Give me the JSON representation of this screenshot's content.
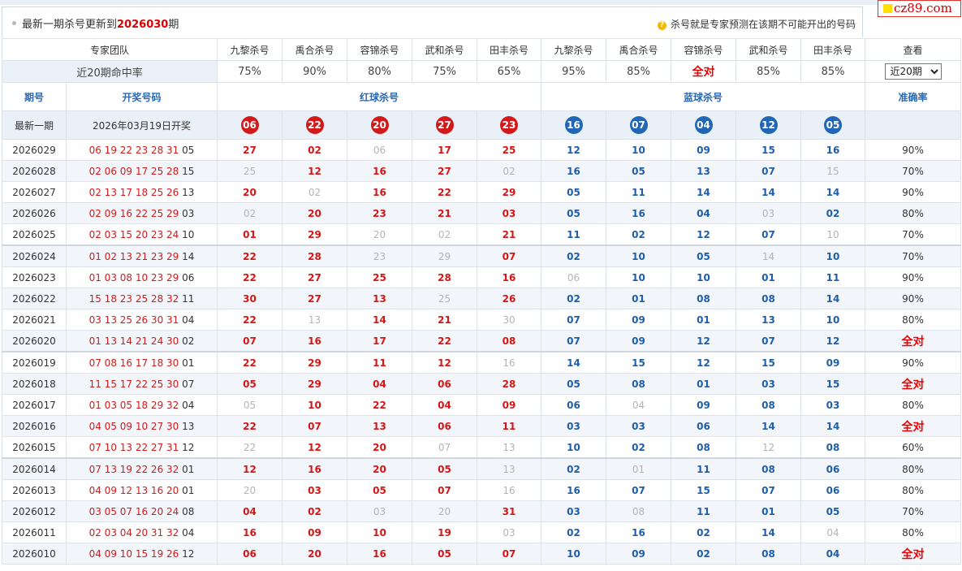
{
  "header": {
    "title_prefix": "最新一期杀号更新到",
    "latest_issue": "2026030",
    "title_suffix": "期",
    "notice": "杀号就是专家预测在该期不可能开出的号码",
    "notice_icon": "question-icon"
  },
  "logo": {
    "text": "cz89.com"
  },
  "team_row": {
    "label": "专家团队",
    "experts": [
      "九黎杀号",
      "禹合杀号",
      "容锦杀号",
      "武和杀号",
      "田丰杀号",
      "九黎杀号",
      "禹合杀号",
      "容锦杀号",
      "武和杀号",
      "田丰杀号"
    ],
    "view_label": "查看"
  },
  "rate_row": {
    "label": "近20期命中率",
    "rates": [
      "75%",
      "90%",
      "80%",
      "75%",
      "65%",
      "95%",
      "85%",
      "全对",
      "85%",
      "85%"
    ],
    "select_value": "近20期"
  },
  "col_headers": {
    "period": "期号",
    "draw": "开奖号码",
    "red_kill": "红球杀号",
    "blue_kill": "蓝球杀号",
    "accuracy": "准确率"
  },
  "latest": {
    "label": "最新一期",
    "draw_date": "2026年03月19日开奖",
    "red": [
      "06",
      "22",
      "20",
      "27",
      "23"
    ],
    "blue": [
      "16",
      "07",
      "04",
      "12",
      "05"
    ]
  },
  "rows": [
    {
      "period": "2026029",
      "draw_red": "06 19 22 23 28 31",
      "draw_blue": "05",
      "red": [
        "27",
        "02",
        "06",
        "17",
        "25"
      ],
      "red_miss": [
        false,
        false,
        true,
        false,
        false
      ],
      "blue": [
        "12",
        "10",
        "09",
        "15",
        "16"
      ],
      "blue_miss": [
        false,
        false,
        false,
        false,
        false
      ],
      "acc": "90%"
    },
    {
      "period": "2026028",
      "draw_red": "02 06 09 17 25 28",
      "draw_blue": "15",
      "red": [
        "25",
        "12",
        "16",
        "27",
        "02"
      ],
      "red_miss": [
        true,
        false,
        false,
        false,
        true
      ],
      "blue": [
        "16",
        "05",
        "13",
        "07",
        "15"
      ],
      "blue_miss": [
        false,
        false,
        false,
        false,
        true
      ],
      "acc": "70%"
    },
    {
      "period": "2026027",
      "draw_red": "02 13 17 18 25 26",
      "draw_blue": "13",
      "red": [
        "20",
        "02",
        "16",
        "22",
        "29"
      ],
      "red_miss": [
        false,
        true,
        false,
        false,
        false
      ],
      "blue": [
        "05",
        "11",
        "14",
        "14",
        "14"
      ],
      "blue_miss": [
        false,
        false,
        false,
        false,
        false
      ],
      "acc": "90%"
    },
    {
      "period": "2026026",
      "draw_red": "02 09 16 22 25 29",
      "draw_blue": "03",
      "red": [
        "02",
        "20",
        "23",
        "21",
        "03"
      ],
      "red_miss": [
        true,
        false,
        false,
        false,
        false
      ],
      "blue": [
        "05",
        "16",
        "04",
        "03",
        "02"
      ],
      "blue_miss": [
        false,
        false,
        false,
        true,
        false
      ],
      "acc": "80%"
    },
    {
      "period": "2026025",
      "draw_red": "02 03 15 20 23 24",
      "draw_blue": "10",
      "red": [
        "01",
        "29",
        "20",
        "02",
        "21"
      ],
      "red_miss": [
        false,
        false,
        true,
        true,
        false
      ],
      "blue": [
        "11",
        "02",
        "12",
        "07",
        "10"
      ],
      "blue_miss": [
        false,
        false,
        false,
        false,
        true
      ],
      "acc": "70%"
    },
    {
      "period": "2026024",
      "draw_red": "01 02 13 21 23 29",
      "draw_blue": "14",
      "red": [
        "22",
        "28",
        "23",
        "29",
        "07"
      ],
      "red_miss": [
        false,
        false,
        true,
        true,
        false
      ],
      "blue": [
        "02",
        "10",
        "05",
        "14",
        "10"
      ],
      "blue_miss": [
        false,
        false,
        false,
        true,
        false
      ],
      "acc": "70%"
    },
    {
      "period": "2026023",
      "draw_red": "01 03 08 10 23 29",
      "draw_blue": "06",
      "red": [
        "22",
        "27",
        "25",
        "28",
        "16"
      ],
      "red_miss": [
        false,
        false,
        false,
        false,
        false
      ],
      "blue": [
        "06",
        "10",
        "10",
        "01",
        "11"
      ],
      "blue_miss": [
        true,
        false,
        false,
        false,
        false
      ],
      "acc": "90%"
    },
    {
      "period": "2026022",
      "draw_red": "15 18 23 25 28 32",
      "draw_blue": "11",
      "red": [
        "30",
        "27",
        "13",
        "25",
        "26"
      ],
      "red_miss": [
        false,
        false,
        false,
        true,
        false
      ],
      "blue": [
        "02",
        "01",
        "08",
        "08",
        "14"
      ],
      "blue_miss": [
        false,
        false,
        false,
        false,
        false
      ],
      "acc": "90%"
    },
    {
      "period": "2026021",
      "draw_red": "03 13 25 26 30 31",
      "draw_blue": "04",
      "red": [
        "22",
        "13",
        "14",
        "21",
        "30"
      ],
      "red_miss": [
        false,
        true,
        false,
        false,
        true
      ],
      "blue": [
        "07",
        "09",
        "01",
        "13",
        "10"
      ],
      "blue_miss": [
        false,
        false,
        false,
        false,
        false
      ],
      "acc": "80%"
    },
    {
      "period": "2026020",
      "draw_red": "01 13 14 21 24 30",
      "draw_blue": "02",
      "red": [
        "07",
        "16",
        "17",
        "22",
        "08"
      ],
      "red_miss": [
        false,
        false,
        false,
        false,
        false
      ],
      "blue": [
        "07",
        "09",
        "12",
        "07",
        "12"
      ],
      "blue_miss": [
        false,
        false,
        false,
        false,
        false
      ],
      "acc": "全对"
    },
    {
      "period": "2026019",
      "draw_red": "07 08 16 17 18 30",
      "draw_blue": "01",
      "red": [
        "22",
        "29",
        "11",
        "12",
        "16"
      ],
      "red_miss": [
        false,
        false,
        false,
        false,
        true
      ],
      "blue": [
        "14",
        "15",
        "12",
        "15",
        "09"
      ],
      "blue_miss": [
        false,
        false,
        false,
        false,
        false
      ],
      "acc": "90%"
    },
    {
      "period": "2026018",
      "draw_red": "11 15 17 22 25 30",
      "draw_blue": "07",
      "red": [
        "05",
        "29",
        "04",
        "06",
        "28"
      ],
      "red_miss": [
        false,
        false,
        false,
        false,
        false
      ],
      "blue": [
        "05",
        "08",
        "01",
        "03",
        "15"
      ],
      "blue_miss": [
        false,
        false,
        false,
        false,
        false
      ],
      "acc": "全对"
    },
    {
      "period": "2026017",
      "draw_red": "01 03 05 18 29 32",
      "draw_blue": "04",
      "red": [
        "05",
        "10",
        "22",
        "04",
        "09"
      ],
      "red_miss": [
        true,
        false,
        false,
        false,
        false
      ],
      "blue": [
        "06",
        "04",
        "09",
        "08",
        "03"
      ],
      "blue_miss": [
        false,
        true,
        false,
        false,
        false
      ],
      "acc": "80%"
    },
    {
      "period": "2026016",
      "draw_red": "04 05 09 10 27 30",
      "draw_blue": "13",
      "red": [
        "22",
        "07",
        "13",
        "06",
        "11"
      ],
      "red_miss": [
        false,
        false,
        false,
        false,
        false
      ],
      "blue": [
        "03",
        "03",
        "06",
        "14",
        "14"
      ],
      "blue_miss": [
        false,
        false,
        false,
        false,
        false
      ],
      "acc": "全对"
    },
    {
      "period": "2026015",
      "draw_red": "07 10 13 22 27 31",
      "draw_blue": "12",
      "red": [
        "22",
        "12",
        "20",
        "07",
        "13"
      ],
      "red_miss": [
        true,
        false,
        false,
        true,
        true
      ],
      "blue": [
        "10",
        "02",
        "08",
        "12",
        "08"
      ],
      "blue_miss": [
        false,
        false,
        false,
        true,
        false
      ],
      "acc": "60%"
    },
    {
      "period": "2026014",
      "draw_red": "07 13 19 22 26 32",
      "draw_blue": "01",
      "red": [
        "12",
        "16",
        "20",
        "05",
        "13"
      ],
      "red_miss": [
        false,
        false,
        false,
        false,
        true
      ],
      "blue": [
        "02",
        "01",
        "11",
        "08",
        "06"
      ],
      "blue_miss": [
        false,
        true,
        false,
        false,
        false
      ],
      "acc": "80%"
    },
    {
      "period": "2026013",
      "draw_red": "04 09 12 13 16 20",
      "draw_blue": "01",
      "red": [
        "20",
        "03",
        "05",
        "07",
        "16"
      ],
      "red_miss": [
        true,
        false,
        false,
        false,
        true
      ],
      "blue": [
        "16",
        "07",
        "15",
        "07",
        "06"
      ],
      "blue_miss": [
        false,
        false,
        false,
        false,
        false
      ],
      "acc": "80%"
    },
    {
      "period": "2026012",
      "draw_red": "03 05 07 16 20 24",
      "draw_blue": "08",
      "red": [
        "04",
        "02",
        "03",
        "20",
        "31"
      ],
      "red_miss": [
        false,
        false,
        true,
        true,
        false
      ],
      "blue": [
        "03",
        "08",
        "11",
        "01",
        "05"
      ],
      "blue_miss": [
        false,
        true,
        false,
        false,
        false
      ],
      "acc": "70%"
    },
    {
      "period": "2026011",
      "draw_red": "02 03 04 20 31 32",
      "draw_blue": "04",
      "red": [
        "16",
        "09",
        "10",
        "19",
        "03"
      ],
      "red_miss": [
        false,
        false,
        false,
        false,
        true
      ],
      "blue": [
        "02",
        "16",
        "02",
        "14",
        "04"
      ],
      "blue_miss": [
        false,
        false,
        false,
        false,
        true
      ],
      "acc": "80%"
    },
    {
      "period": "2026010",
      "draw_red": "04 09 10 15 19 26",
      "draw_blue": "12",
      "red": [
        "06",
        "20",
        "16",
        "05",
        "07"
      ],
      "red_miss": [
        false,
        false,
        false,
        false,
        false
      ],
      "blue": [
        "10",
        "09",
        "02",
        "08",
        "04"
      ],
      "blue_miss": [
        false,
        false,
        false,
        false,
        false
      ],
      "acc": "全对"
    }
  ],
  "colors": {
    "accent_red": "#d21a1a",
    "accent_blue": "#2366b4",
    "miss_gray": "#b4b4b4",
    "header_blue": "#2a69b5"
  }
}
